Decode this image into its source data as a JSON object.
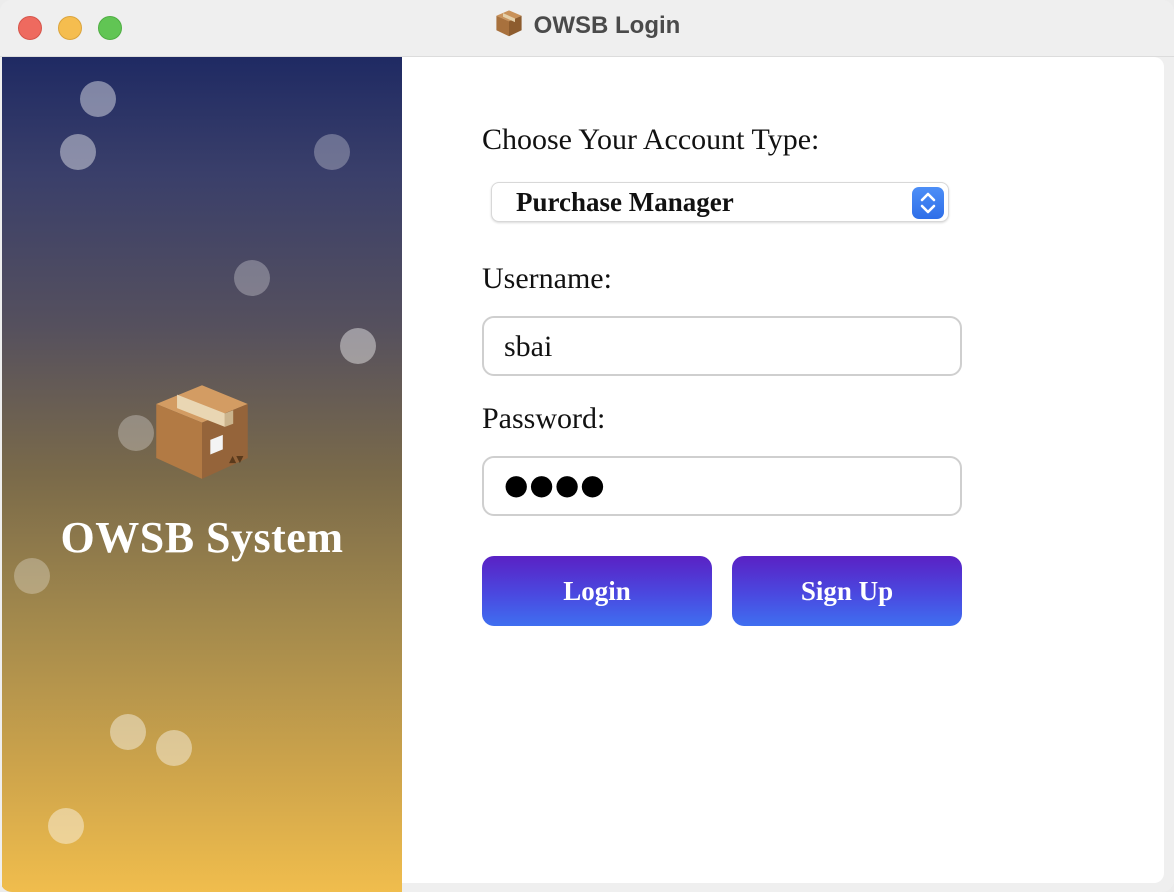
{
  "window": {
    "title": "OWSB Login",
    "title_icon": "package-box-icon"
  },
  "left_panel": {
    "logo_icon": "package-box-icon",
    "system_title": "OWSB System",
    "gradient_colors": [
      "#1f2a63",
      "#7a6a4a",
      "#f0bd4d"
    ]
  },
  "form": {
    "account_type_label": "Choose Your Account Type:",
    "account_type_selected": "Purchase Manager",
    "username_label": "Username:",
    "username_value": "sbai",
    "password_label": "Password:",
    "password_mask": "●●●●",
    "login_label": "Login",
    "signup_label": "Sign Up"
  },
  "colors": {
    "button_gradient_top": "#5a21c4",
    "button_gradient_bottom": "#3f6ff0",
    "select_stepper": "#2f6fe8"
  }
}
